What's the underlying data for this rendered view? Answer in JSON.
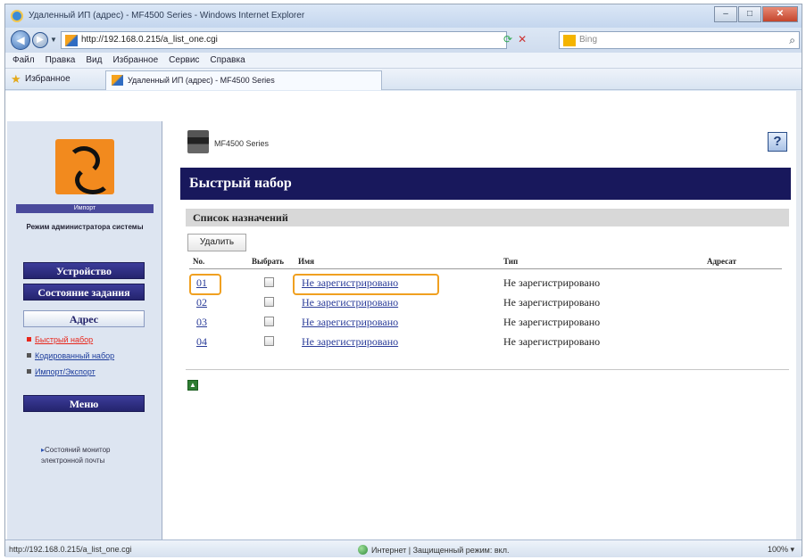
{
  "window": {
    "title": "Удаленный ИП (адрес) - MF4500 Series - Windows Internet Explorer",
    "controls": [
      "–",
      "□",
      "✕"
    ]
  },
  "navbar": {
    "url": "http://192.168.0.215/a_list_one.cgi",
    "search_placeholder": "Bing"
  },
  "menubar": [
    "Файл",
    "Правка",
    "Вид",
    "Избранное",
    "Сервис",
    "Справка"
  ],
  "favbar": {
    "favorites_label": "Избранное",
    "tab_title": "Удаленный ИП (адрес) - MF4500 Series"
  },
  "sidebar": {
    "mode_label": "Импорт",
    "admin_mode": "Режим администратора системы",
    "buttons": {
      "device": "Устройство",
      "job_status": "Состояние задания",
      "address": "Адрес",
      "menu": "Меню"
    },
    "sub_items": [
      "Быстрый набор",
      "Кодированный набор",
      "Импорт/Экспорт"
    ],
    "monitor_link": "Состояний монитор электронной почты"
  },
  "content": {
    "model": "MF4500 Series",
    "help": "?",
    "page_title": "Быстрый набор",
    "section_title": "Список назначений",
    "delete_button": "Удалить",
    "columns": {
      "no": "No.",
      "select": "Выбрать",
      "name": "Имя",
      "type": "Тип",
      "address": "Адресат"
    },
    "rows": [
      {
        "no": "01",
        "name": "Не зарегистрировано",
        "type": "Не зарегистрировано"
      },
      {
        "no": "02",
        "name": "Не зарегистрировано",
        "type": "Не зарегистрировано"
      },
      {
        "no": "03",
        "name": "Не зарегистрировано",
        "type": "Не зарегистрировано"
      },
      {
        "no": "04",
        "name": "Не зарегистрировано",
        "type": "Не зарегистрировано"
      }
    ]
  },
  "statusbar": {
    "url": "http://192.168.0.215/a_list_one.cgi",
    "zone": "Интернет | Защищенный режим: вкл.",
    "zoom": "100%"
  },
  "colors": {
    "header_navy": "#18185c",
    "sidebar_button": "#2c2c80",
    "highlight": "#f0a020",
    "link": "#2a3c99",
    "active_link": "#e8261b"
  }
}
